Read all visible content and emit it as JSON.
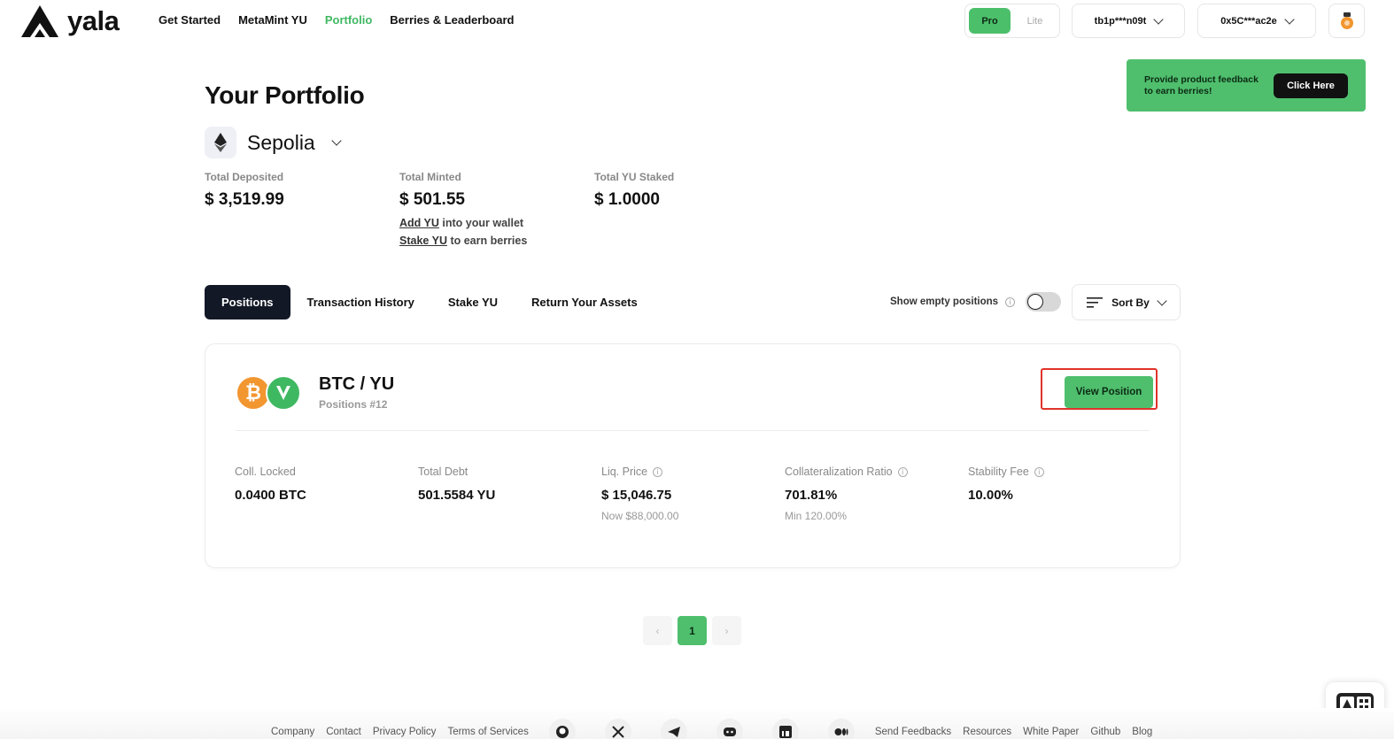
{
  "header": {
    "logo_text": "yala",
    "nav": [
      "Get Started",
      "MetaMint YU",
      "Portfolio",
      "Berries & Leaderboard"
    ],
    "active_nav": "Portfolio",
    "mode": {
      "pro": "Pro",
      "lite": "Lite"
    },
    "btc_wallet": "tb1p***n09t",
    "evm_wallet": "0x5C***ac2e"
  },
  "feedback": {
    "text": "Provide product feedback to earn berries!",
    "button": "Click Here"
  },
  "portfolio": {
    "title": "Your Portfolio",
    "network": "Sepolia",
    "stats": {
      "deposited_label": "Total Deposited",
      "deposited_value": "$ 3,519.99",
      "minted_label": "Total Minted",
      "minted_value": "$ 501.55",
      "add_yu_link": "Add YU",
      "add_yu_text": "into your wallet",
      "stake_yu_link": "Stake YU",
      "stake_yu_text": "to earn berries",
      "staked_label": "Total YU Staked",
      "staked_value": "$ 1.0000"
    }
  },
  "tabs": [
    "Positions",
    "Transaction History",
    "Stake YU",
    "Return Your Assets"
  ],
  "active_tab": "Positions",
  "controls": {
    "show_empty_label": "Show empty positions",
    "show_empty_on": false,
    "sort_label": "Sort By"
  },
  "position": {
    "pair": "BTC / YU",
    "subtitle": "Positions #12",
    "view_button": "View Position",
    "metrics": {
      "coll_label": "Coll. Locked",
      "coll_value": "0.0400 BTC",
      "debt_label": "Total Debt",
      "debt_value": "501.5584 YU",
      "liq_label": "Liq. Price",
      "liq_value": "$ 15,046.75",
      "liq_sub": "Now $88,000.00",
      "ratio_label": "Collateralization Ratio",
      "ratio_value": "701.81%",
      "ratio_sub": "Min 120.00%",
      "fee_label": "Stability Fee",
      "fee_value": "10.00%"
    }
  },
  "pagination": {
    "current": "1",
    "prev": "‹",
    "next": "›"
  },
  "footer": {
    "links_left": [
      "Company",
      "Contact",
      "Privacy Policy",
      "Terms of Services"
    ],
    "links_right": [
      "Send Feedbacks",
      "Resources",
      "White Paper",
      "Github",
      "Blog"
    ],
    "social_icons": [
      "github-icon",
      "x-icon",
      "telegram-icon",
      "discord-icon",
      "linkedin-icon",
      "medium-icon"
    ]
  },
  "colors": {
    "accent": "#4fbf6d",
    "nav_active": "#3fb862",
    "dark": "#121826",
    "btc": "#f29630",
    "highlight": "#e0342a"
  }
}
